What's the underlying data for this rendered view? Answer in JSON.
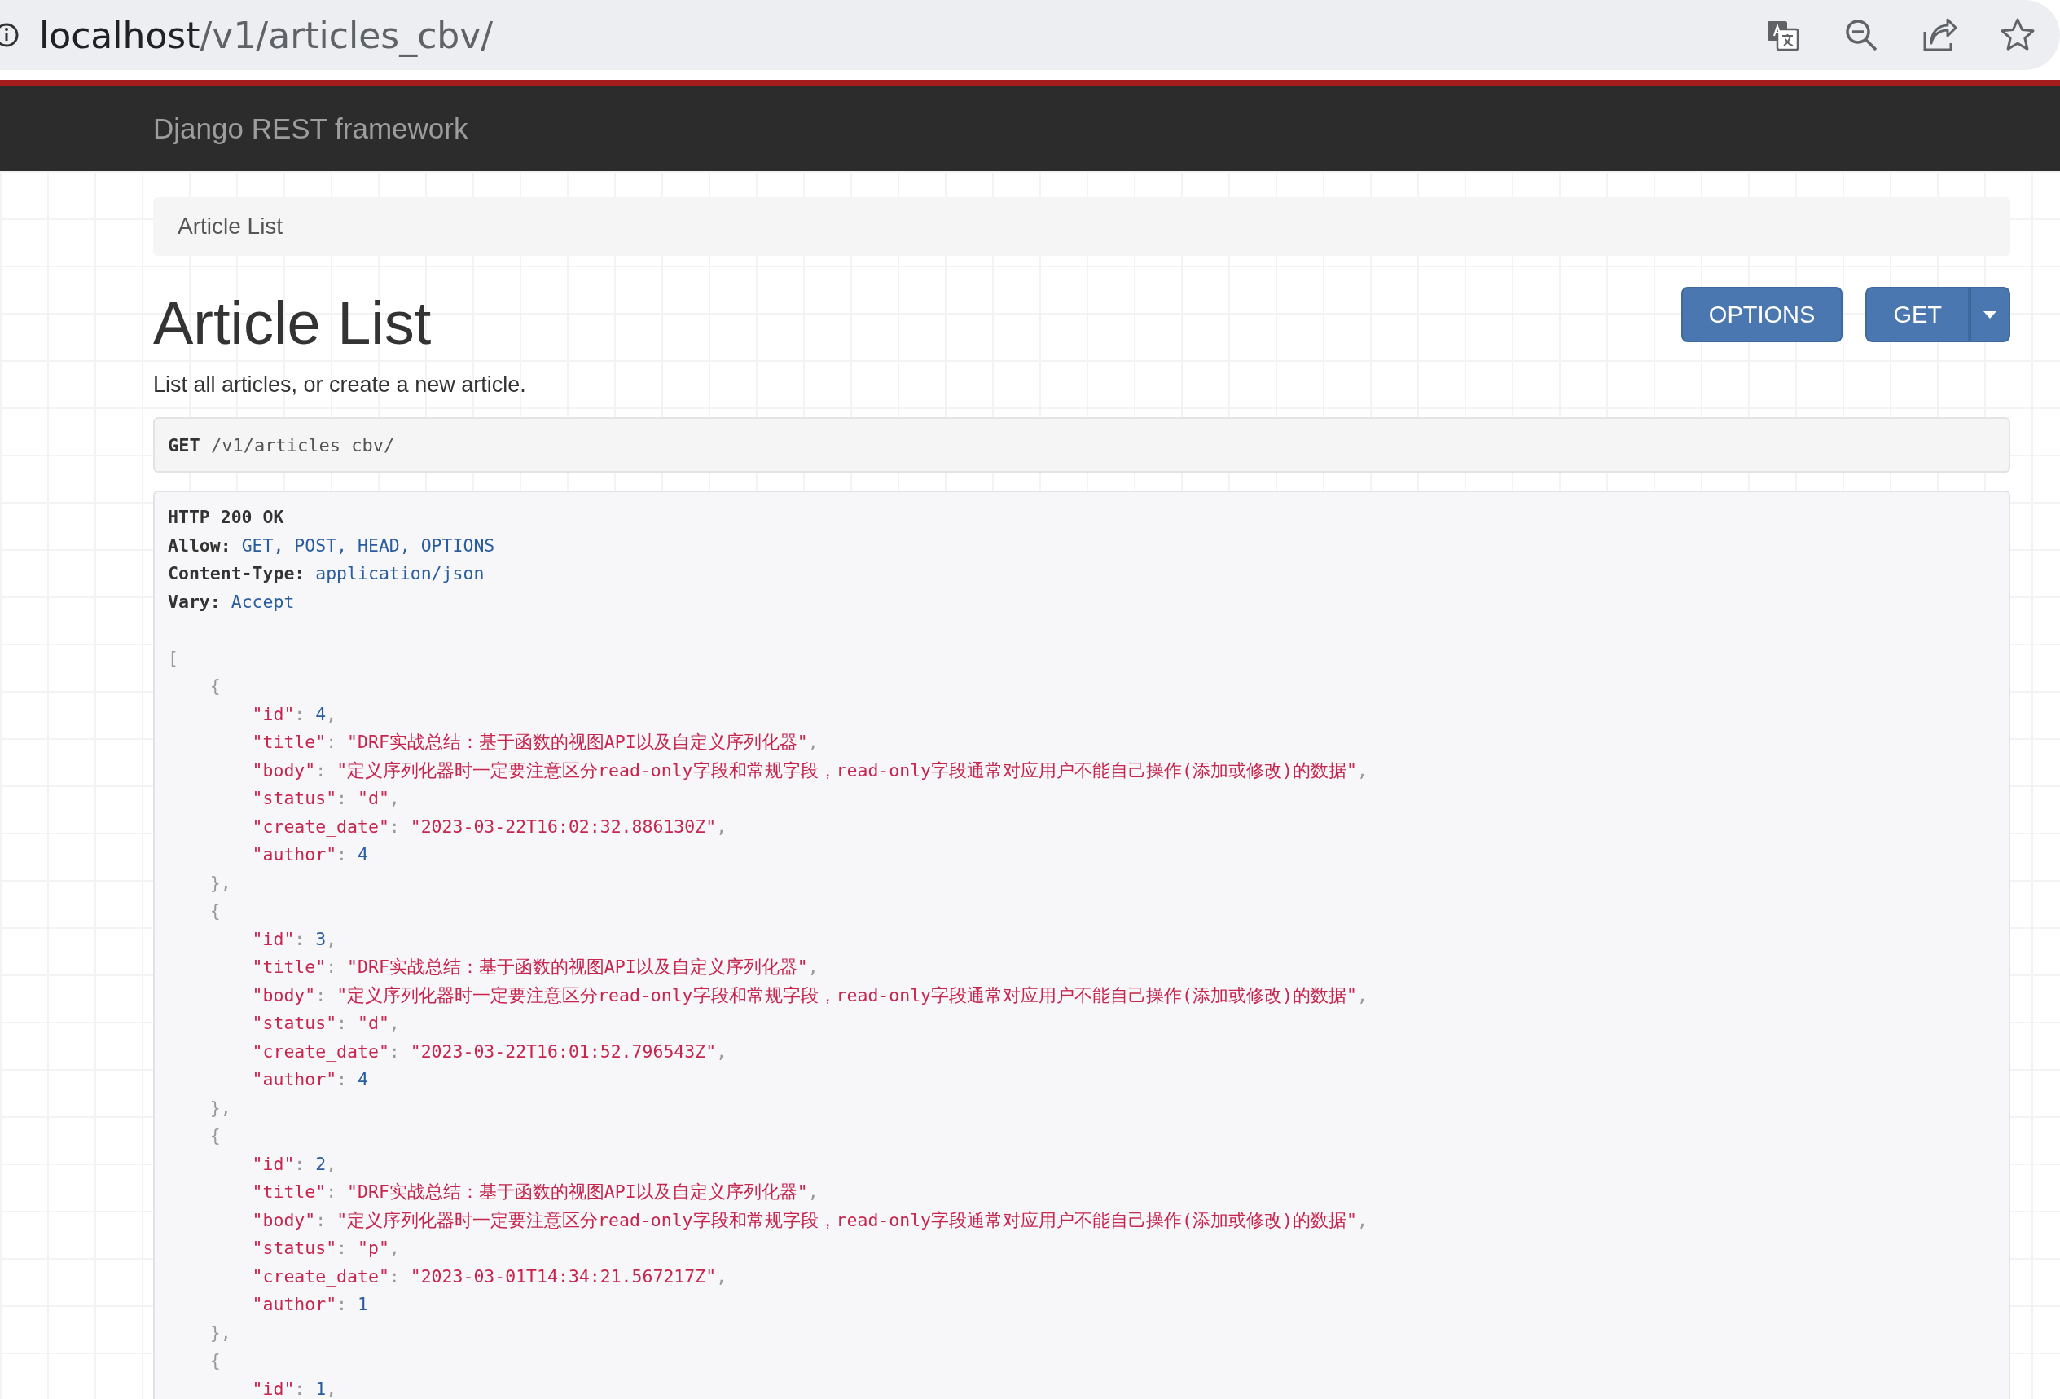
{
  "browser": {
    "url": {
      "host": "localhost",
      "path": "/v1/articles_cbv/"
    }
  },
  "navbar": {
    "brand": "Django REST framework"
  },
  "breadcrumb": [
    {
      "label": "Article List",
      "selected": true
    }
  ],
  "page": {
    "title": "Article List",
    "description": "List all articles, or create a new article.",
    "buttons": [
      {
        "label": "OPTIONS",
        "kind": "plain"
      },
      {
        "label": "GET",
        "kind": "split"
      }
    ]
  },
  "request": {
    "method": "GET",
    "path": "/v1/articles_cbv/"
  },
  "response": {
    "status_line": "HTTP 200 OK",
    "headers": [
      {
        "name": "Allow:",
        "value": "GET, POST, HEAD, OPTIONS"
      },
      {
        "name": "Content-Type:",
        "value": "application/json"
      },
      {
        "name": "Vary:",
        "value": "Accept"
      }
    ],
    "body": {
      "open": "[",
      "items": [
        {
          "open": "{",
          "close": "},",
          "fields": [
            {
              "key": "\"id\"",
              "colon": ":",
              "value": "4",
              "kind": "number",
              "comma": ","
            },
            {
              "key": "\"title\"",
              "colon": ":",
              "value": "\"DRF实战总结：基于函数的视图API以及自定义序列化器\"",
              "kind": "string",
              "comma": ","
            },
            {
              "key": "\"body\"",
              "colon": ":",
              "value": "\"定义序列化器时一定要注意区分read-only字段和常规字段，read-only字段通常对应用户不能自己操作(添加或修改)的数据\"",
              "kind": "string",
              "comma": ","
            },
            {
              "key": "\"status\"",
              "colon": ":",
              "value": "\"d\"",
              "kind": "string",
              "comma": ","
            },
            {
              "key": "\"create_date\"",
              "colon": ":",
              "value": "\"2023-03-22T16:02:32.886130Z\"",
              "kind": "string",
              "comma": ","
            },
            {
              "key": "\"author\"",
              "colon": ":",
              "value": "4",
              "kind": "number"
            }
          ]
        },
        {
          "open": "{",
          "close": "},",
          "fields": [
            {
              "key": "\"id\"",
              "colon": ":",
              "value": "3",
              "kind": "number",
              "comma": ","
            },
            {
              "key": "\"title\"",
              "colon": ":",
              "value": "\"DRF实战总结：基于函数的视图API以及自定义序列化器\"",
              "kind": "string",
              "comma": ","
            },
            {
              "key": "\"body\"",
              "colon": ":",
              "value": "\"定义序列化器时一定要注意区分read-only字段和常规字段，read-only字段通常对应用户不能自己操作(添加或修改)的数据\"",
              "kind": "string",
              "comma": ","
            },
            {
              "key": "\"status\"",
              "colon": ":",
              "value": "\"d\"",
              "kind": "string",
              "comma": ","
            },
            {
              "key": "\"create_date\"",
              "colon": ":",
              "value": "\"2023-03-22T16:01:52.796543Z\"",
              "kind": "string",
              "comma": ","
            },
            {
              "key": "\"author\"",
              "colon": ":",
              "value": "4",
              "kind": "number"
            }
          ]
        },
        {
          "open": "{",
          "close": "},",
          "fields": [
            {
              "key": "\"id\"",
              "colon": ":",
              "value": "2",
              "kind": "number",
              "comma": ","
            },
            {
              "key": "\"title\"",
              "colon": ":",
              "value": "\"DRF实战总结：基于函数的视图API以及自定义序列化器\"",
              "kind": "string",
              "comma": ","
            },
            {
              "key": "\"body\"",
              "colon": ":",
              "value": "\"定义序列化器时一定要注意区分read-only字段和常规字段，read-only字段通常对应用户不能自己操作(添加或修改)的数据\"",
              "kind": "string",
              "comma": ","
            },
            {
              "key": "\"status\"",
              "colon": ":",
              "value": "\"p\"",
              "kind": "string",
              "comma": ","
            },
            {
              "key": "\"create_date\"",
              "colon": ":",
              "value": "\"2023-03-01T14:34:21.567217Z\"",
              "kind": "string",
              "comma": ","
            },
            {
              "key": "\"author\"",
              "colon": ":",
              "value": "1",
              "kind": "number"
            }
          ]
        },
        {
          "open": "{",
          "fields": [
            {
              "key": "\"id\"",
              "colon": ":",
              "value": "1",
              "kind": "number",
              "comma": ","
            }
          ]
        }
      ]
    }
  }
}
